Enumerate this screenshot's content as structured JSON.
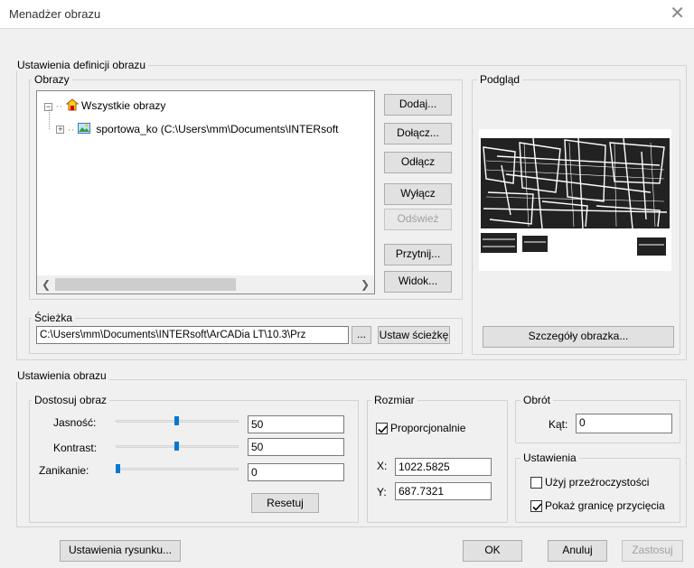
{
  "window": {
    "title": "Menadżer obrazu",
    "close": "✕"
  },
  "definition": {
    "group_label": "Ustawienia definicji obrazu",
    "images_label": "Obrazy",
    "tree": {
      "root_label": "Wszystkie obrazy",
      "child_label": "sportowa_ko  (C:\\Users\\mm\\Documents\\INTERsoft"
    },
    "buttons": {
      "add": "Dodaj...",
      "attach": "Dołącz...",
      "detach": "Odłącz",
      "unload": "Wyłącz",
      "reload": "Odśwież",
      "clip": "Przytnij...",
      "view": "Widok..."
    },
    "preview_label": "Podgląd",
    "path_label": "Ścieżka",
    "path_value": "C:\\Users\\mm\\Documents\\INTERsoft\\ArCADia LT\\10.3\\Prz",
    "browse": "...",
    "set_path": "Ustaw ścieżkę",
    "details": "Szczegóły obrazka..."
  },
  "image_settings": {
    "group_label": "Ustawienia obrazu",
    "adjust": {
      "label": "Dostosuj obraz",
      "brightness": {
        "label": "Jasność:",
        "value": "50",
        "level": 0.5
      },
      "contrast": {
        "label": "Kontrast:",
        "value": "50",
        "level": 0.5
      },
      "fade": {
        "label": "Zanikanie:",
        "value": "0",
        "level": 0
      },
      "reset": "Resetuj"
    },
    "size": {
      "label": "Rozmiar",
      "proportional": "Proporcjonalnie",
      "proportional_checked": true,
      "x_label": "X:",
      "x_value": "1022.5825",
      "y_label": "Y:",
      "y_value": "687.7321"
    },
    "rotation": {
      "label": "Obrót",
      "angle_label": "Kąt:",
      "angle_value": "0"
    },
    "settings": {
      "label": "Ustawienia",
      "transparency": "Użyj przeźroczystości",
      "transparency_checked": false,
      "clip_border": "Pokaż granicę przycięcia",
      "clip_border_checked": true
    }
  },
  "footer": {
    "drawing_settings": "Ustawienia rysunku...",
    "ok": "OK",
    "cancel": "Anuluj",
    "apply": "Zastosuj"
  }
}
